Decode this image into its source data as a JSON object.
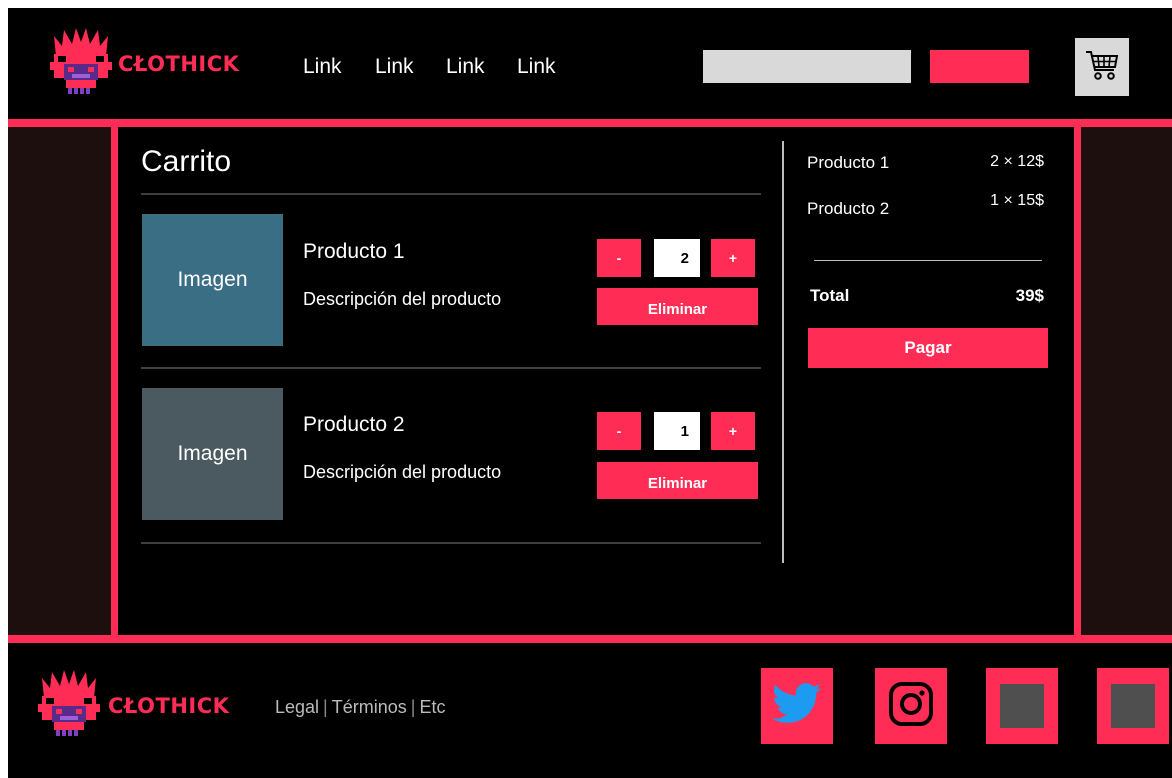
{
  "header": {
    "brand": "CŁOTHICK",
    "nav_links": [
      "Link",
      "Link",
      "Link",
      "Link"
    ],
    "search_placeholder": ""
  },
  "cart": {
    "title": "Carrito",
    "items": [
      {
        "image_label": "Imagen",
        "image_color": "#3a6e85",
        "name": "Producto 1",
        "description": "Descripción del producto",
        "quantity": "2",
        "minus_label": "-",
        "plus_label": "+",
        "remove_label": "Eliminar"
      },
      {
        "image_label": "Imagen",
        "image_color": "#4a5a60",
        "name": "Producto 2",
        "description": "Descripción del producto",
        "quantity": "1",
        "minus_label": "-",
        "plus_label": "+",
        "remove_label": "Eliminar"
      }
    ]
  },
  "summary": {
    "lines": [
      {
        "name": "Producto 1",
        "qty_price": "2 × 12$"
      },
      {
        "name": "Producto 2",
        "qty_price": "1 × 15$"
      }
    ],
    "total_label": "Total",
    "total_value": "39$",
    "pay_label": "Pagar"
  },
  "footer": {
    "brand": "CŁOTHICK",
    "links": [
      "Legal",
      "Términos",
      "Etc"
    ],
    "social": [
      "twitter-icon",
      "instagram-icon",
      "placeholder-icon",
      "placeholder-icon"
    ]
  },
  "colors": {
    "accent": "#ff2d55",
    "background": "#000000",
    "side_panel": "#1e0f0f",
    "placeholder_gray": "#d9d9d9"
  }
}
